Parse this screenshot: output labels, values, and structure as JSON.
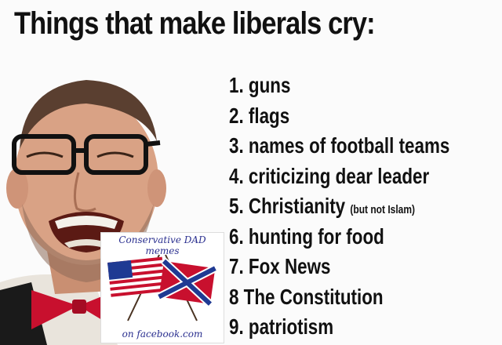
{
  "title": "Things that make liberals cry:",
  "list": [
    {
      "text": "1. guns"
    },
    {
      "text": "2. flags"
    },
    {
      "text": "3. names of football teams"
    },
    {
      "text": "4. criticizing dear leader"
    },
    {
      "text": "5. Christianity",
      "note": "(but not Islam)"
    },
    {
      "text": "6. hunting for food"
    },
    {
      "text": "7. Fox News"
    },
    {
      "text": "8 The Constitution"
    },
    {
      "text": "9. patriotism"
    }
  ],
  "badge": {
    "top": "Conservative DAD memes",
    "bottom": "on facebook.com"
  },
  "colors": {
    "text": "#111111",
    "badge_text": "#2a2f8f",
    "bowtie": "#c8102e",
    "flag_red": "#c8102e",
    "flag_blue": "#1f3a93"
  }
}
